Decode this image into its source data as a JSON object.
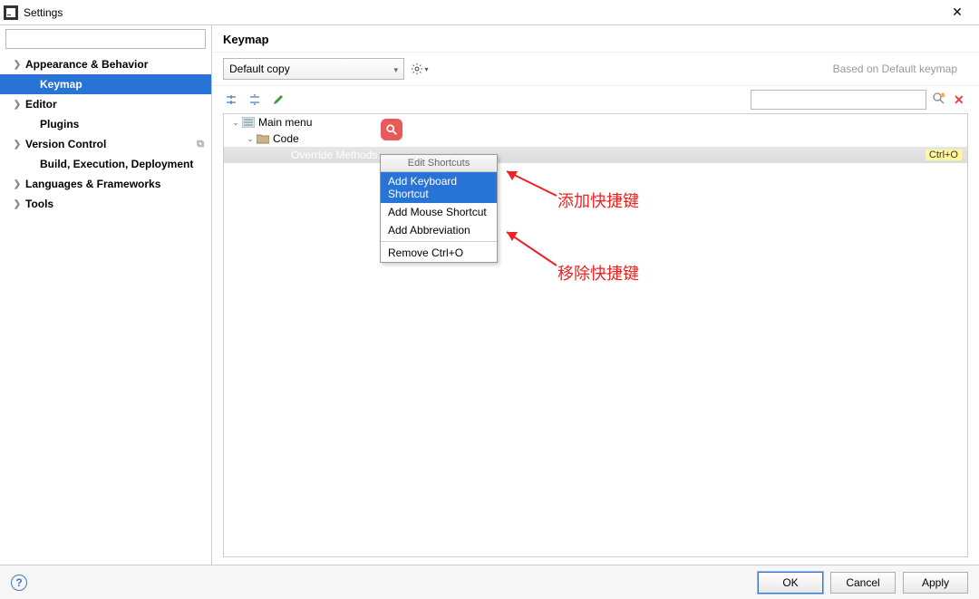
{
  "window": {
    "title": "Settings",
    "close": "✕"
  },
  "sidebar": {
    "search_placeholder": "",
    "items": [
      {
        "label": "Appearance & Behavior",
        "expandable": true,
        "bold": true
      },
      {
        "label": "Keymap",
        "expandable": false,
        "bold": true,
        "selected": true,
        "indent": true
      },
      {
        "label": "Editor",
        "expandable": true,
        "bold": true
      },
      {
        "label": "Plugins",
        "expandable": false,
        "bold": true,
        "indent": true
      },
      {
        "label": "Version Control",
        "expandable": true,
        "bold": true,
        "vc_badge": true
      },
      {
        "label": "Build, Execution, Deployment",
        "expandable": false,
        "bold": true,
        "indent": true
      },
      {
        "label": "Languages & Frameworks",
        "expandable": true,
        "bold": true
      },
      {
        "label": "Tools",
        "expandable": true,
        "bold": true
      }
    ]
  },
  "main": {
    "title": "Keymap",
    "scheme": "Default copy",
    "based_on": "Based on Default keymap",
    "find_placeholder": "",
    "tree": {
      "root": "Main menu",
      "child": "Code",
      "action": "Override Methods...",
      "shortcut": "Ctrl+O"
    }
  },
  "context_menu": {
    "header": "Edit Shortcuts",
    "items": [
      "Add Keyboard Shortcut",
      "Add Mouse Shortcut",
      "Add Abbreviation"
    ],
    "remove": "Remove Ctrl+O"
  },
  "annotations": {
    "add": "添加快捷键",
    "remove": "移除快捷键"
  },
  "footer": {
    "ok": "OK",
    "cancel": "Cancel",
    "apply": "Apply"
  }
}
